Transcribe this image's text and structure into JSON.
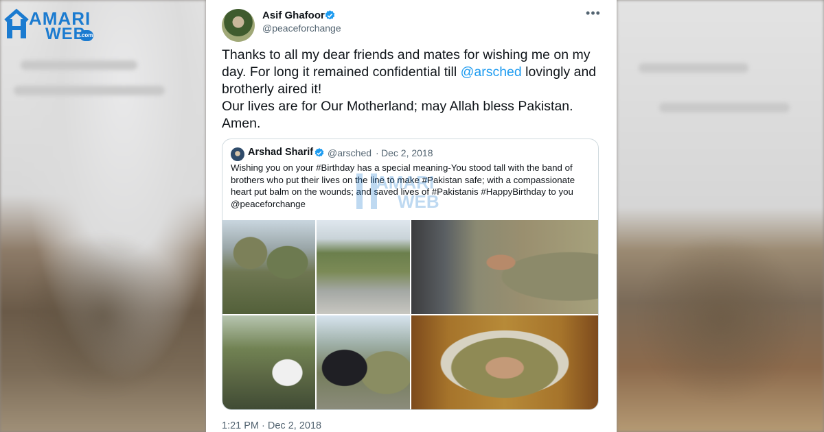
{
  "site_logo": {
    "word1": "AMARI",
    "word2": "WEB",
    "suffix": ".com",
    "brand_color": "#1b7bd0"
  },
  "tweet": {
    "author_name": "Asif Ghafoor",
    "author_handle": "@peaceforchange",
    "verified": true,
    "text_part1": "Thanks to all my dear friends and mates for wishing me on my day. For long it remained confidential till ",
    "mention": "@arsched",
    "text_part2": " lovingly and brotherly aired it!",
    "text_line2": "Our lives are for Our Motherland; may Allah bless Pakistan. Amen.",
    "timestamp": "1:21 PM · Dec 2, 2018",
    "more_icon": "more-horizontal-icon",
    "link_color": "#1d9bf0"
  },
  "quoted_tweet": {
    "author_name": "Arshad Sharif",
    "author_handle": "@arsched",
    "separator": "·",
    "date": "Dec 2, 2018",
    "verified": true,
    "text": "Wishing you on your #Birthday has a special meaning-You stood tall with the band of brothers who put their lives on the line to make #Pakistan safe; with a compassionate heart put balm on the wounds; and saved lives of #Pakistanis  #HappyBirthday to you @peaceforchange",
    "watermark_word1": "AMARI",
    "watermark_word2": "WEB",
    "photos": [
      {
        "description": "soldiers-with-rifles"
      },
      {
        "description": "soldiers-walking-on-road"
      },
      {
        "description": "soldier-in-vehicle"
      },
      {
        "description": "soldiers-with-civilian"
      },
      {
        "description": "officers-walking"
      },
      {
        "description": "portrait-painting-of-officer"
      }
    ]
  }
}
